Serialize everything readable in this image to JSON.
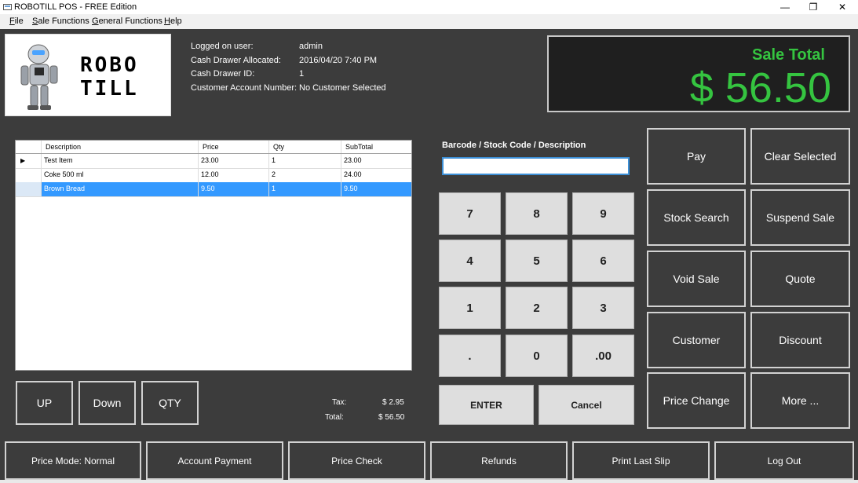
{
  "window": {
    "title": "ROBOTILL POS - FREE Edition",
    "controls": {
      "minimize": "—",
      "maximize": "❐",
      "close": "✕"
    }
  },
  "menu": [
    {
      "label": "File",
      "accel": "F",
      "rest": "ile"
    },
    {
      "label": "Sale Functions",
      "accel": "S",
      "rest": "ale Functions"
    },
    {
      "label": "General Functions",
      "accel": "G",
      "rest": "eneral Functions"
    },
    {
      "label": "Help",
      "accel": "H",
      "rest": "elp"
    }
  ],
  "logo": {
    "text_line1": "ROBO",
    "text_line2": "TILL"
  },
  "info": {
    "logged_user_label": "Logged on user:",
    "logged_user_value": "admin",
    "drawer_allocated_label": "Cash Drawer Allocated:",
    "drawer_allocated_value": "2016/04/20 7:40 PM",
    "drawer_id_label": "Cash Drawer ID:",
    "drawer_id_value": "1",
    "customer_label": "Customer Account Number:",
    "customer_value": "No Customer Selected"
  },
  "sale_total": {
    "label": "Sale Total",
    "amount": "$ 56.50",
    "color": "#35c440"
  },
  "grid": {
    "columns": [
      "Description",
      "Price",
      "Qty",
      "SubTotal"
    ],
    "rows": [
      {
        "description": "Test Item",
        "price": "23.00",
        "qty": "1",
        "subtotal": "23.00",
        "selected": false,
        "current": true
      },
      {
        "description": "Coke 500 ml",
        "price": "12.00",
        "qty": "2",
        "subtotal": "24.00",
        "selected": false,
        "current": false
      },
      {
        "description": "Brown Bread",
        "price": "9.50",
        "qty": "1",
        "subtotal": "9.50",
        "selected": true,
        "current": false
      }
    ],
    "selection_color": "#3399ff"
  },
  "barcode": {
    "label": "Barcode / Stock Code / Description",
    "value": ""
  },
  "keypad": {
    "keys": [
      "7",
      "8",
      "9",
      "4",
      "5",
      "6",
      "1",
      "2",
      "3",
      ".",
      "0",
      ".00"
    ],
    "enter": "ENTER",
    "cancel": "Cancel"
  },
  "actions": {
    "pay": "Pay",
    "clear_selected": "Clear Selected",
    "stock_search": "Stock Search",
    "suspend_sale": "Suspend Sale",
    "void_sale": "Void Sale",
    "quote": "Quote",
    "customer": "Customer",
    "discount": "Discount",
    "price_change": "Price Change",
    "more": "More ..."
  },
  "row_controls": {
    "up": "UP",
    "down": "Down",
    "qty": "QTY"
  },
  "totals": {
    "tax_label": "Tax:",
    "tax_value": "$ 2.95",
    "total_label": "Total:",
    "total_value": "$ 56.50"
  },
  "bottom_buttons": {
    "price_mode": "Price Mode: Normal",
    "account_payment": "Account Payment",
    "price_check": "Price Check",
    "refunds": "Refunds",
    "print_last_slip": "Print Last Slip",
    "log_out": "Log Out"
  }
}
